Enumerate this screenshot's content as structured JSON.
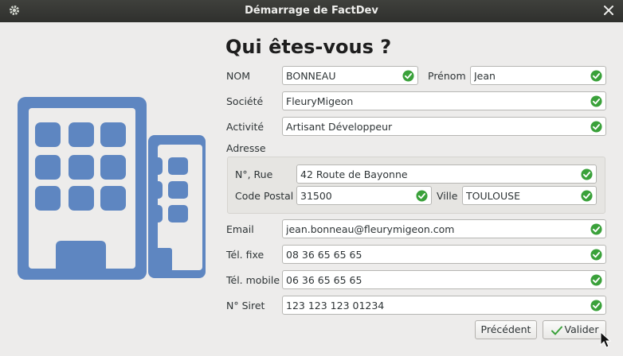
{
  "window": {
    "title": "Démarrage de FactDev"
  },
  "heading": "Qui êtes-vous ?",
  "form": {
    "nom_label": "NOM",
    "nom_value": "BONNEAU",
    "prenom_label": "Prénom",
    "prenom_value": "Jean",
    "societe_label": "Société",
    "societe_value": "FleuryMigeon",
    "activite_label": "Activité",
    "activite_value": "Artisant Développeur",
    "adresse_label": "Adresse",
    "rue_label": "N°, Rue",
    "rue_value": "42 Route de Bayonne",
    "cp_label": "Code Postal",
    "cp_value": "31500",
    "ville_label": "Ville",
    "ville_value": "TOULOUSE",
    "email_label": "Email",
    "email_value": "jean.bonneau@fleurymigeon.com",
    "tel_fixe_label": "Tél. fixe",
    "tel_fixe_value": "08 36 65 65 65",
    "tel_mobile_label": "Tél. mobile",
    "tel_mobile_value": "06 36 65 65 65",
    "siret_label": "N° Siret",
    "siret_value": "123 123 123 01234"
  },
  "buttons": {
    "previous": "Précédent",
    "validate": "Valider"
  },
  "colors": {
    "valid": "#3aa13a",
    "illustration": "#5e86c1",
    "titlebar": "#393a36"
  },
  "icons": {
    "window": "gear-icon",
    "close": "close-icon",
    "valid": "check-circle-icon",
    "illustration": "buildings-icon"
  }
}
